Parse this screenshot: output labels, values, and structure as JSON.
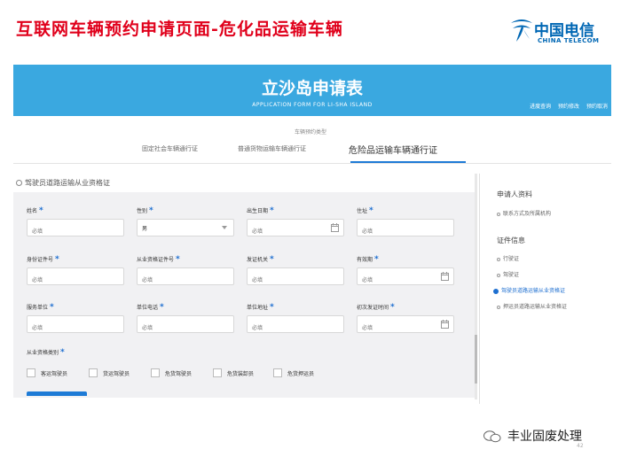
{
  "slide_title": "互联网车辆预约申请页面-危化品运输车辆",
  "logo": {
    "cn": "中国电信",
    "en": "CHINA TELECOM",
    "color": "#0067b4"
  },
  "hero": {
    "title": "立沙岛申请表",
    "subtitle": "APPLICATION FORM FOR LI-SHA ISLAND",
    "links": [
      "进度查询",
      "预约修改",
      "预约取消"
    ],
    "bg": "#3aa8e0"
  },
  "type_label": "车辆预约类型",
  "tabs": [
    {
      "label": "固定社会车辆通行证",
      "active": false
    },
    {
      "label": "普通货物运输车辆通行证",
      "active": false
    },
    {
      "label": "危险品运输车辆通行证",
      "active": true
    }
  ],
  "section_title": "驾驶员道路运输从业资格证",
  "fields": {
    "name": {
      "label": "姓名",
      "placeholder": "必填"
    },
    "gender": {
      "label": "性别",
      "value": "男"
    },
    "birth": {
      "label": "出生日期",
      "placeholder": "必填"
    },
    "address": {
      "label": "住址",
      "placeholder": "必填"
    },
    "id_no": {
      "label": "身份证件号",
      "placeholder": "必填"
    },
    "cert_no": {
      "label": "从业资格证件号",
      "placeholder": "必填"
    },
    "issuer": {
      "label": "发证机关",
      "placeholder": "必填"
    },
    "valid": {
      "label": "有效期",
      "placeholder": "必填"
    },
    "employer": {
      "label": "服务单位",
      "placeholder": "必填"
    },
    "phone": {
      "label": "单位电话",
      "placeholder": "必填"
    },
    "emp_addr": {
      "label": "单位地址",
      "placeholder": "必填"
    },
    "first_issue": {
      "label": "初次发证时间",
      "placeholder": "必填"
    }
  },
  "qualification": {
    "label": "从业资格类别",
    "options": [
      "客运驾驶员",
      "货运驾驶员",
      "危货驾驶员",
      "危货装卸员",
      "危货押运员"
    ]
  },
  "sidebar": {
    "groups": [
      {
        "title": "申请人资料",
        "items": [
          {
            "label": "联系方式及所属机构",
            "active": false
          }
        ]
      },
      {
        "title": "证件信息",
        "items": [
          {
            "label": "行驶证",
            "active": false
          },
          {
            "label": "驾驶证",
            "active": false
          },
          {
            "label": "驾驶员道路运输从业资格证",
            "active": true
          },
          {
            "label": "押运员道路运输从业资格证",
            "active": false
          }
        ]
      }
    ]
  },
  "watermark": "丰业固废处理",
  "page_number": "42",
  "required_mark": "*",
  "accent": "#1e7bd6"
}
